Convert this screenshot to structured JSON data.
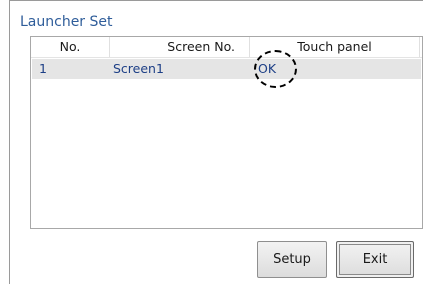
{
  "window": {
    "title": "Launcher Set"
  },
  "list": {
    "columns": [
      "No.",
      "Screen No.",
      "Touch panel"
    ],
    "rows": [
      {
        "no": "1",
        "screen_no": "Screen1",
        "touch_panel": "OK"
      }
    ]
  },
  "buttons": {
    "setup": "Setup",
    "exit": "Exit"
  },
  "colors": {
    "title_text": "#2f5d9a",
    "row_text": "#1d3f86",
    "selected_row_bg": "#e5e5e5"
  }
}
